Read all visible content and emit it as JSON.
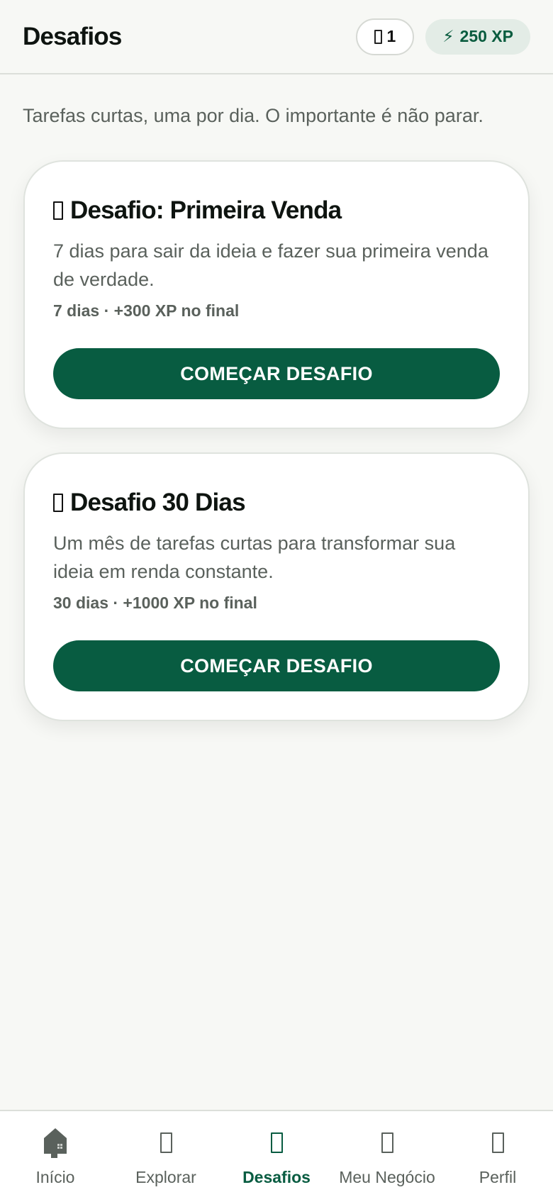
{
  "header": {
    "title": "Desafios",
    "streak_count": "1",
    "xp_icon": "lightning-icon",
    "xp_glyph": "⚡",
    "xp_label": "250 XP"
  },
  "subtitle": "Tarefas curtas, uma por dia. O importante é não parar.",
  "challenges": [
    {
      "title": "Desafio: Primeira Venda",
      "description": "7 dias para sair da ideia e fazer sua primeira venda de verdade.",
      "meta": "7 dias · +300 XP no final",
      "button_label": "COMEÇAR DESAFIO"
    },
    {
      "title": "Desafio 30 Dias",
      "description": "Um mês de tarefas curtas para transformar sua ideia em renda constante.",
      "meta": "30 dias · +1000 XP no final",
      "button_label": "COMEÇAR DESAFIO"
    }
  ],
  "nav": {
    "items": [
      {
        "label": "Início",
        "icon": "home-icon"
      },
      {
        "label": "Explorar",
        "icon": "explore-icon"
      },
      {
        "label": "Desafios",
        "icon": "challenges-icon"
      },
      {
        "label": "Meu Negócio",
        "icon": "business-icon"
      },
      {
        "label": "Perfil",
        "icon": "profile-icon"
      }
    ],
    "active": "Desafios"
  },
  "colors": {
    "primary": "#085c41",
    "background": "#f7f8f5",
    "card": "#ffffff",
    "muted_text": "#5a615c",
    "xp_pill_bg": "#e3ece6"
  }
}
